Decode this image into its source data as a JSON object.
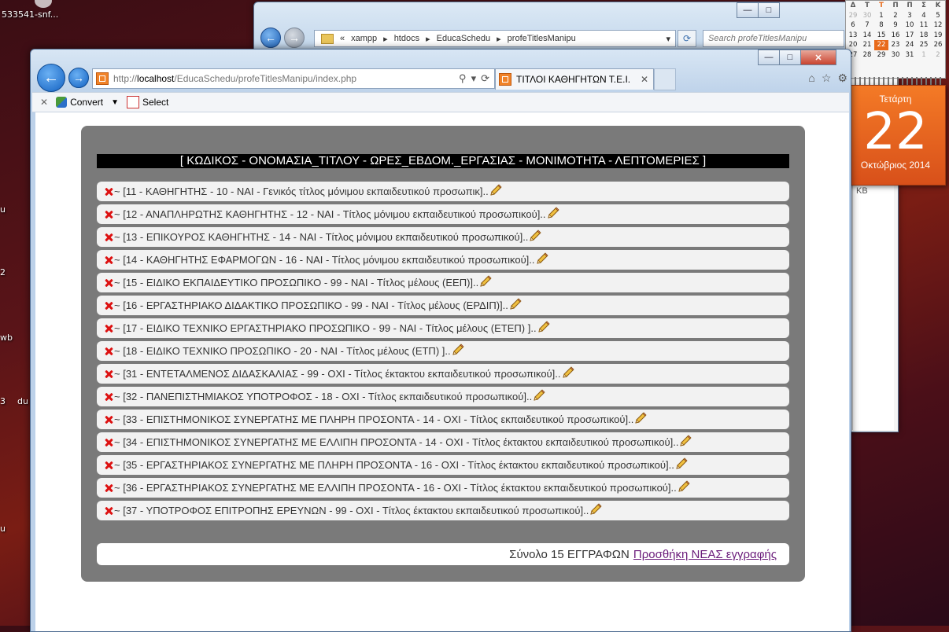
{
  "desktop": {
    "items": [
      "533541-snf...",
      "u",
      "2",
      "wb",
      "3",
      "du",
      "u"
    ]
  },
  "back_window": {
    "path": [
      "xampp",
      "htdocs",
      "EducaSchedu",
      "profeTitlesManipu"
    ],
    "search_placeholder": "Search profeTitlesManipu",
    "side_text": "KB"
  },
  "calendar": {
    "weekdays": [
      "Δ",
      "Τ",
      "Τ",
      "Π",
      "Π",
      "Σ",
      "Κ"
    ],
    "weeks": [
      [
        "29",
        "30",
        "1",
        "2",
        "3",
        "4",
        "5"
      ],
      [
        "6",
        "7",
        "8",
        "9",
        "10",
        "11",
        "12"
      ],
      [
        "13",
        "14",
        "15",
        "16",
        "17",
        "18",
        "19"
      ],
      [
        "20",
        "21",
        "22",
        "23",
        "24",
        "25",
        "26"
      ],
      [
        "27",
        "28",
        "29",
        "30",
        "31",
        "1",
        "2"
      ]
    ],
    "weekday_name": "Τετάρτη",
    "day": "22",
    "month_year": "Οκτώβριος 2014"
  },
  "browser": {
    "url_prefix": "http://",
    "url_host": "localhost",
    "url_path": "/EducaSchedu/profeTitlesManipu/index.php",
    "tab_title": "ΤΙΤΛΟΙ ΚΑΘΗΓΗΤΩΝ Τ.Ε.Ι.",
    "toolbar": {
      "convert": "Convert",
      "select": "Select"
    }
  },
  "page": {
    "header": "[ ΚΩΔΙΚΟΣ - ΟΝΟΜΑΣΙΑ_ΤΙΤΛΟΥ - ΩΡΕΣ_ΕΒΔΟΜ._ΕΡΓΑΣΙΑΣ - ΜΟΝΙΜΟΤΗΤΑ - ΛΕΠΤΟΜΕΡΙΕΣ ]",
    "rows": [
      "~ [11 - ΚΑΘΗΓΗΤΗΣ - 10 - ΝΑΙ - Γενικός τίτλος μόνιμου εκπαιδευτικού προσωπικ]..",
      "~ [12 - ΑΝΑΠΛΗΡΩΤΗΣ ΚΑΘΗΓΗΤΗΣ - 12 - ΝΑΙ - Τίτλος μόνιμου εκπαιδευτικού προσωπικού]..",
      "~ [13 - ΕΠΙΚΟΥΡΟΣ ΚΑΘΗΓΗΤΗΣ - 14 - ΝΑΙ - Τίτλος μόνιμου εκπαιδευτικού προσωπικού]..",
      "~ [14 - ΚΑΘΗΓΗΤΗΣ ΕΦΑΡΜΟΓΩΝ - 16 - ΝΑΙ - Τίτλος μόνιμου εκπαιδευτικού προσωπικού]..",
      "~ [15 - ΕΙΔΙΚΟ ΕΚΠΑΙΔΕΥΤΙΚΟ ΠΡΟΣΩΠΙΚΟ - 99 - ΝΑΙ - Τίτλος μέλους (ΕΕΠ)]..",
      "~ [16 - ΕΡΓΑΣΤΗΡΙΑΚΟ ΔΙΔΑΚΤΙΚΟ ΠΡΟΣΩΠΙΚΟ - 99 - ΝΑΙ - Τίτλος μέλους (ΕΡΔΙΠ)]..",
      "~ [17 - ΕΙΔΙΚΟ ΤΕΧΝΙΚΟ ΕΡΓΑΣΤΗΡΙΑΚΟ ΠΡΟΣΩΠΙΚΟ - 99 - ΝΑΙ - Τίτλος μέλους (ΕΤΕΠ) ]..",
      "~ [18 - ΕΙΔΙΚΟ ΤΕΧΝΙΚΟ ΠΡΟΣΩΠΙΚΟ - 20 - ΝΑΙ - Τίτλος μέλους (ΕΤΠ) ]..",
      "~ [31 - ΕΝΤΕΤΑΛΜΕΝΟΣ ΔΙΔΑΣΚΑΛΙΑΣ - 99 - ΟΧΙ - Τίτλος έκτακτου εκπαιδευτικού προσωπικού]..",
      "~ [32 - ΠΑΝΕΠΙΣΤΗΜΙΑΚΟΣ ΥΠΟΤΡΟΦΟΣ - 18 - ΟΧΙ - Τίτλος εκπαιδευτικού προσωπικού]..",
      "~ [33 - ΕΠΙΣΤΗΜΟΝΙΚΟΣ ΣΥΝΕΡΓΑΤΗΣ ΜΕ ΠΛΗΡΗ ΠΡΟΣΟΝΤΑ - 14 - ΟΧΙ - Τίτλος εκπαιδευτικού προσωπικού]..",
      "~ [34 - ΕΠΙΣΤΗΜΟΝΙΚΟΣ ΣΥΝΕΡΓΑΤΗΣ ΜΕ ΕΛΛΙΠΗ ΠΡΟΣΟΝΤΑ - 14 - ΟΧΙ - Τίτλος έκτακτου εκπαιδευτικού προσωπικού]..",
      "~ [35 - ΕΡΓΑΣΤΗΡΙΑΚΟΣ ΣΥΝΕΡΓΑΤΗΣ ΜΕ ΠΛΗΡΗ ΠΡΟΣΟΝΤΑ - 16 - ΟΧΙ - Τίτλος έκτακτου εκπαιδευτικού προσωπικού]..",
      "~ [36 - ΕΡΓΑΣΤΗΡΙΑΚΟΣ ΣΥΝΕΡΓΑΤΗΣ ΜΕ ΕΛΛΙΠΗ ΠΡΟΣΟΝΤΑ - 16 - ΟΧΙ - Τίτλος έκτακτου εκπαιδευτικού προσωπικού]..",
      "~ [37 - ΥΠΟΤΡΟΦΟΣ ΕΠΙΤΡΟΠΗΣ ΕΡΕΥΝΩΝ - 99 - ΟΧΙ - Τίτλος έκτακτου εκπαιδευτικού προσωπικού].."
    ],
    "footer_total": "Σύνολο 15 ΕΓΓΡΑΦΩΝ",
    "footer_link": "Προσθήκη ΝΕΑΣ εγγραφής"
  },
  "colors": {
    "panel": "#7a7a7a",
    "row": "#f2f2f2",
    "header_bg": "#000000",
    "link": "#6a1b7a",
    "delete": "#dd1111",
    "calendar_accent": "#e86a1a"
  },
  "icons": {
    "row_delete": "delete-x-icon",
    "row_edit": "pencil-icon"
  }
}
